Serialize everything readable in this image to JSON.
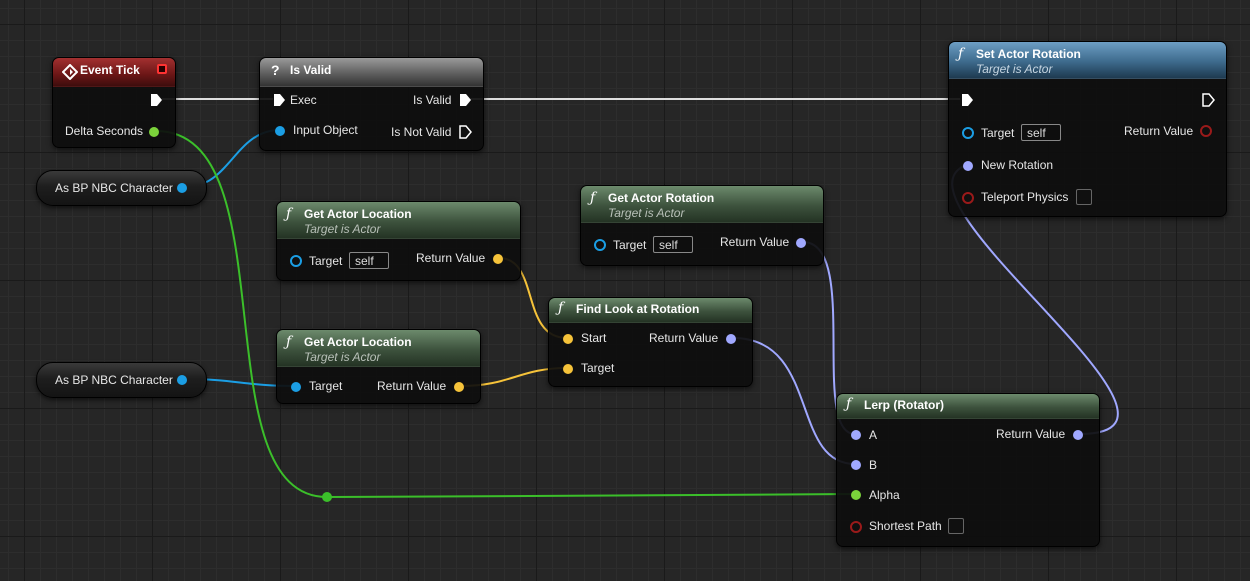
{
  "colors": {
    "exec": "#ffffff",
    "float": "#7bd33b",
    "object": "#1b9ee4",
    "vector": "#f6c33a",
    "rotator": "#a0a8ff",
    "bool": "#9a1a1a",
    "reroute": "#3bbf2a"
  },
  "nodes": {
    "event_tick": {
      "title": "Event Tick",
      "icon": "event-diamond-icon",
      "out_delta": "Delta Seconds"
    },
    "is_valid": {
      "title": "Is Valid",
      "icon": "question-icon",
      "in_exec": "Exec",
      "in_object": "Input Object",
      "out_valid": "Is Valid",
      "out_not_valid": "Is Not Valid"
    },
    "set_actor_rotation": {
      "title": "Set Actor Rotation",
      "subtitle": "Target is Actor",
      "target": "Target",
      "target_default": "self",
      "new_rotation": "New Rotation",
      "teleport": "Teleport Physics",
      "return": "Return Value"
    },
    "get_actor_location_1": {
      "title": "Get Actor Location",
      "subtitle": "Target is Actor",
      "target": "Target",
      "target_default": "self",
      "return": "Return Value"
    },
    "get_actor_location_2": {
      "title": "Get Actor Location",
      "subtitle": "Target is Actor",
      "target": "Target",
      "return": "Return Value"
    },
    "get_actor_rotation": {
      "title": "Get Actor Rotation",
      "subtitle": "Target is Actor",
      "target": "Target",
      "target_default": "self",
      "return": "Return Value"
    },
    "find_look_at": {
      "title": "Find Look at Rotation",
      "start": "Start",
      "target": "Target",
      "return": "Return Value"
    },
    "lerp_rotator": {
      "title": "Lerp (Rotator)",
      "a": "A",
      "b": "B",
      "alpha": "Alpha",
      "shortest": "Shortest Path",
      "return": "Return Value"
    }
  },
  "variables": {
    "var_1": "As BP NBC Character",
    "var_2": "As BP NBC Character"
  }
}
